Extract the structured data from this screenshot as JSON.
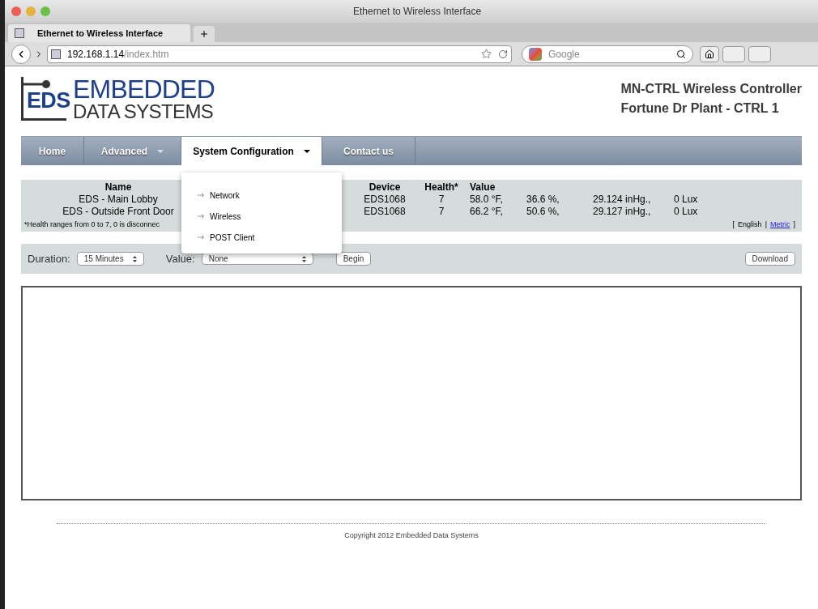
{
  "window": {
    "title": "Ethernet to Wireless Interface"
  },
  "tabs": [
    {
      "label": "Ethernet to Wireless Interface",
      "selected": true
    }
  ],
  "address_bar": {
    "host": "192.168.1.14",
    "path": "/index.htm"
  },
  "search": {
    "placeholder": "Google"
  },
  "logo": {
    "mark": "EDS",
    "line1": "EMBEDDED",
    "line2": "DATA SYSTEMS"
  },
  "header": {
    "line1": "MN-CTRL Wireless Controller",
    "line2": "Fortune Dr Plant - CTRL 1"
  },
  "nav": [
    {
      "label": "Home",
      "selected": false,
      "dropdown": false
    },
    {
      "label": "Advanced",
      "selected": false,
      "dropdown": true
    },
    {
      "label": "System Configuration",
      "selected": true,
      "dropdown": true
    },
    {
      "label": "Contact us",
      "selected": false,
      "dropdown": false
    }
  ],
  "dropdown_menu": [
    "Network",
    "Wireless",
    "POST Client"
  ],
  "sensor_table": {
    "columns": [
      "Name",
      "Device",
      "Health*",
      "Value"
    ],
    "rows": [
      {
        "name": "EDS - Main Lobby",
        "device": "EDS1068",
        "health": "7",
        "values": [
          "58.0 °F,",
          "36.6 %,",
          "29.124 inHg.,",
          "0 Lux"
        ]
      },
      {
        "name": "EDS - Outside Front Door",
        "device": "EDS1068",
        "health": "7",
        "values": [
          "66.2 °F,",
          "50.6 %,",
          "29.127 inHg.,",
          "0 Lux"
        ]
      }
    ],
    "note": "*Health ranges from 0 to 7, 0 is disconnec",
    "units_open": "[",
    "units_separator": "|",
    "units_close": "]",
    "units": [
      {
        "label": "English",
        "selected": true
      },
      {
        "label": "Metric",
        "selected": false
      }
    ]
  },
  "controls": {
    "duration_label": "Duration:",
    "duration": "15 Minutes",
    "value_label": "Value:",
    "value": "None",
    "begin": "Begin",
    "download": "Download"
  },
  "footer": "Copyright 2012 Embedded Data Systems"
}
